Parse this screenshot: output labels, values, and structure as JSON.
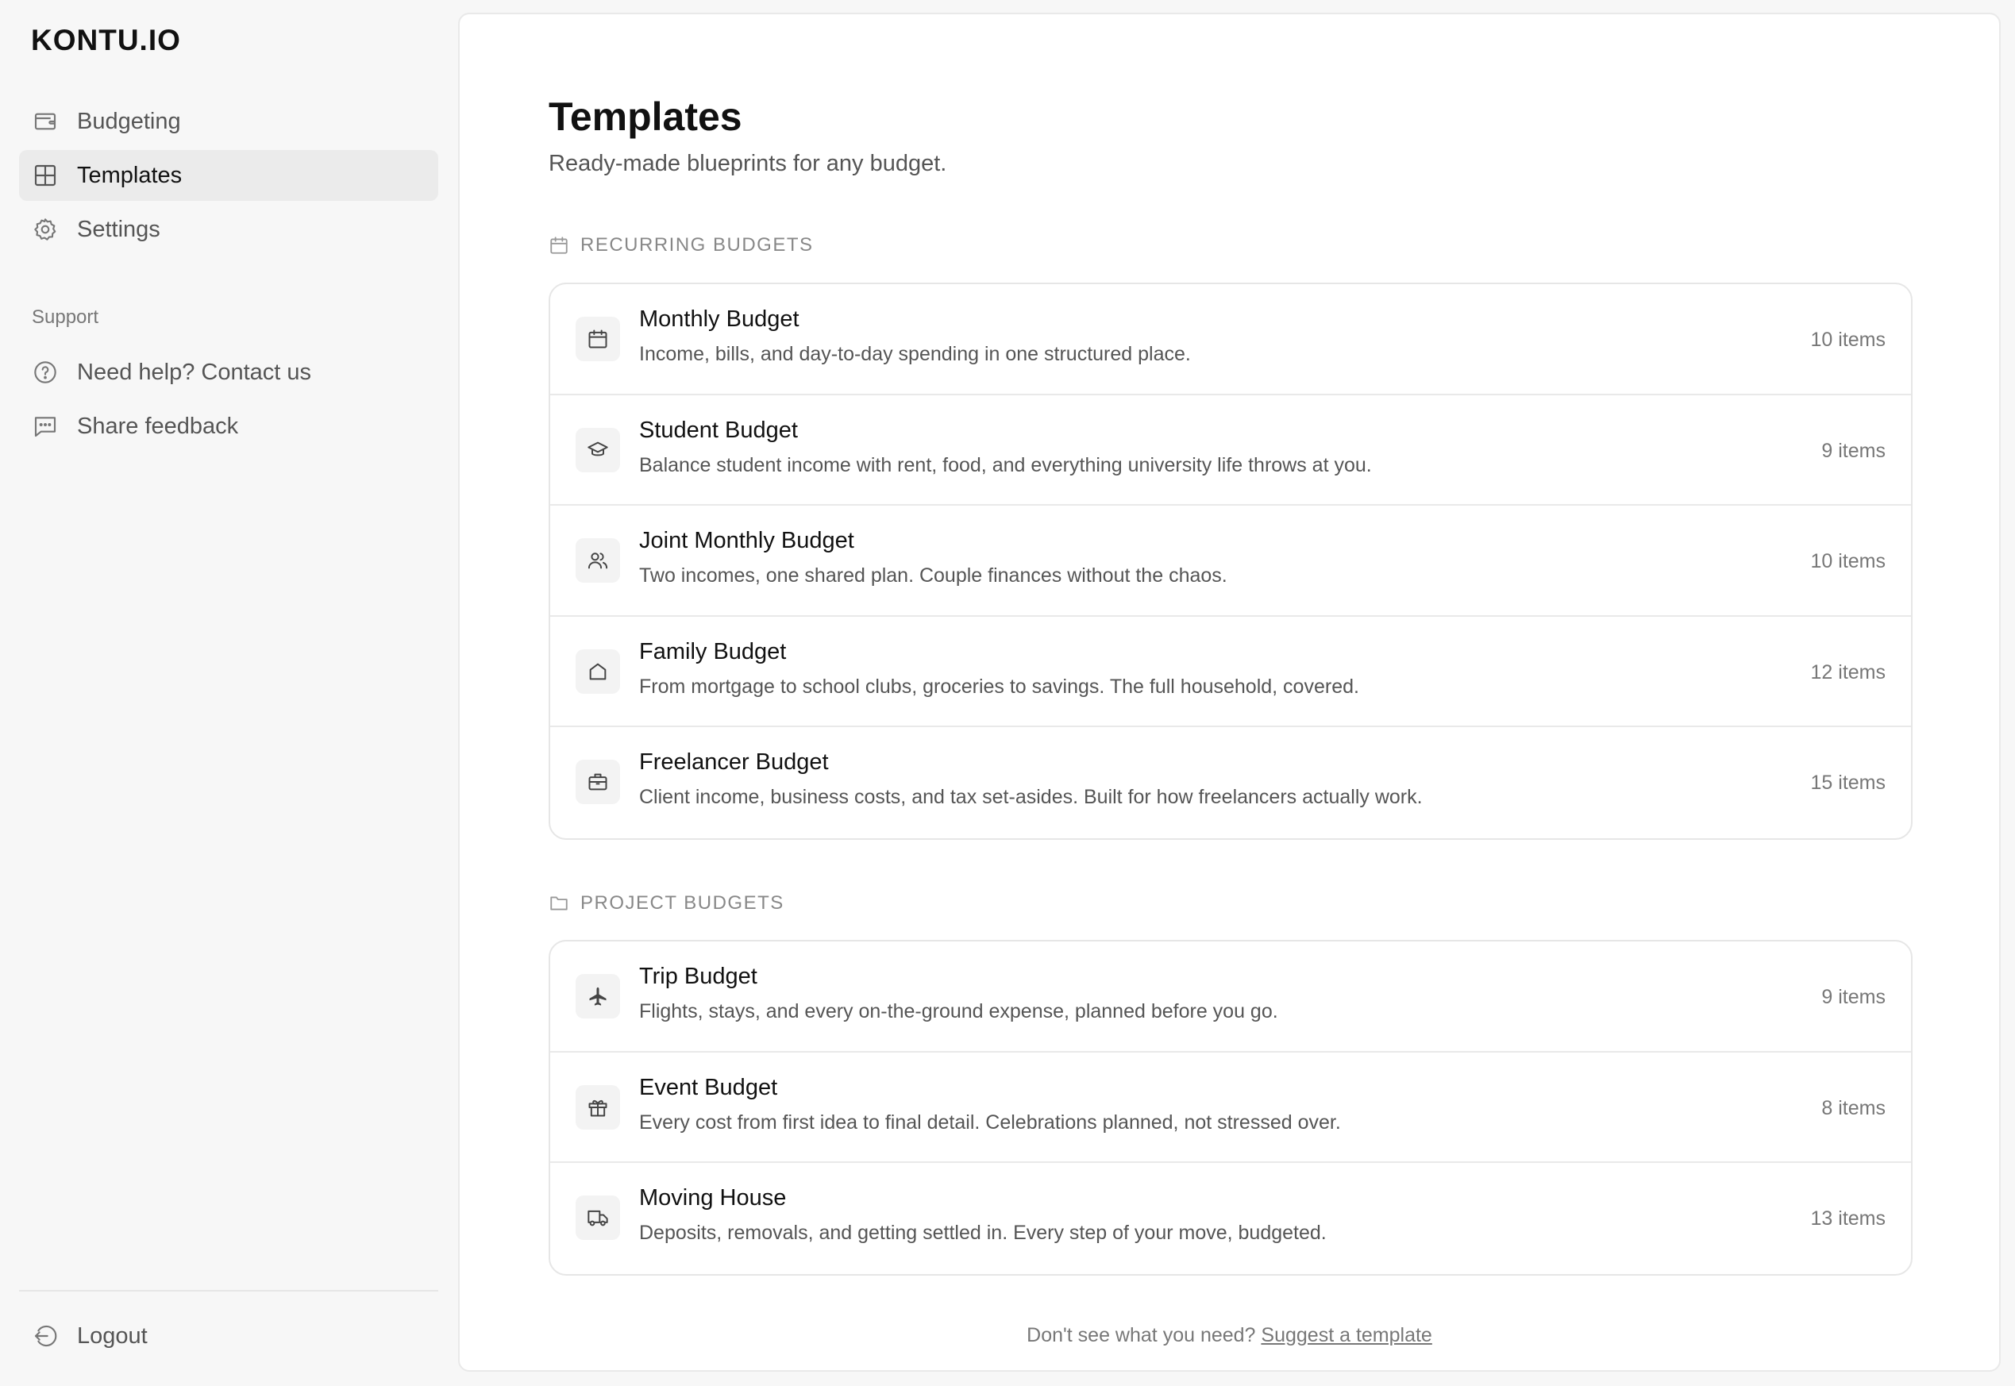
{
  "app": {
    "logo": "KONTU.IO"
  },
  "sidebar": {
    "nav": [
      {
        "label": "Budgeting",
        "icon": "wallet-icon"
      },
      {
        "label": "Templates",
        "icon": "grid-icon",
        "active": true
      },
      {
        "label": "Settings",
        "icon": "gear-icon"
      }
    ],
    "support_label": "Support",
    "support": [
      {
        "label": "Need help? Contact us",
        "icon": "help-circle-icon"
      },
      {
        "label": "Share feedback",
        "icon": "message-icon"
      }
    ],
    "logout_label": "Logout"
  },
  "main": {
    "title": "Templates",
    "subtitle": "Ready-made blueprints for any budget.",
    "groups": [
      {
        "header": "RECURRING BUDGETS",
        "icon": "calendar-icon",
        "items": [
          {
            "title": "Monthly Budget",
            "desc": "Income, bills, and day-to-day spending in one structured place.",
            "count": "10 items",
            "icon": "calendar-icon"
          },
          {
            "title": "Student Budget",
            "desc": "Balance student income with rent, food, and everything university life throws at you.",
            "count": "9 items",
            "icon": "graduation-cap-icon"
          },
          {
            "title": "Joint Monthly Budget",
            "desc": "Two incomes, one shared plan. Couple finances without the chaos.",
            "count": "10 items",
            "icon": "users-icon"
          },
          {
            "title": "Family Budget",
            "desc": "From mortgage to school clubs, groceries to savings. The full household, covered.",
            "count": "12 items",
            "icon": "home-icon"
          },
          {
            "title": "Freelancer Budget",
            "desc": "Client income, business costs, and tax set-asides. Built for how freelancers actually work.",
            "count": "15 items",
            "icon": "briefcase-icon"
          }
        ]
      },
      {
        "header": "PROJECT BUDGETS",
        "icon": "folder-icon",
        "items": [
          {
            "title": "Trip Budget",
            "desc": "Flights, stays, and every on-the-ground expense, planned before you go.",
            "count": "9 items",
            "icon": "plane-icon"
          },
          {
            "title": "Event Budget",
            "desc": "Every cost from first idea to final detail. Celebrations planned, not stressed over.",
            "count": "8 items",
            "icon": "gift-icon"
          },
          {
            "title": "Moving House",
            "desc": "Deposits, removals, and getting settled in. Every step of your move, budgeted.",
            "count": "13 items",
            "icon": "truck-icon"
          }
        ]
      }
    ],
    "footer_text": "Don't see what you need?",
    "footer_link": "Suggest a template"
  }
}
